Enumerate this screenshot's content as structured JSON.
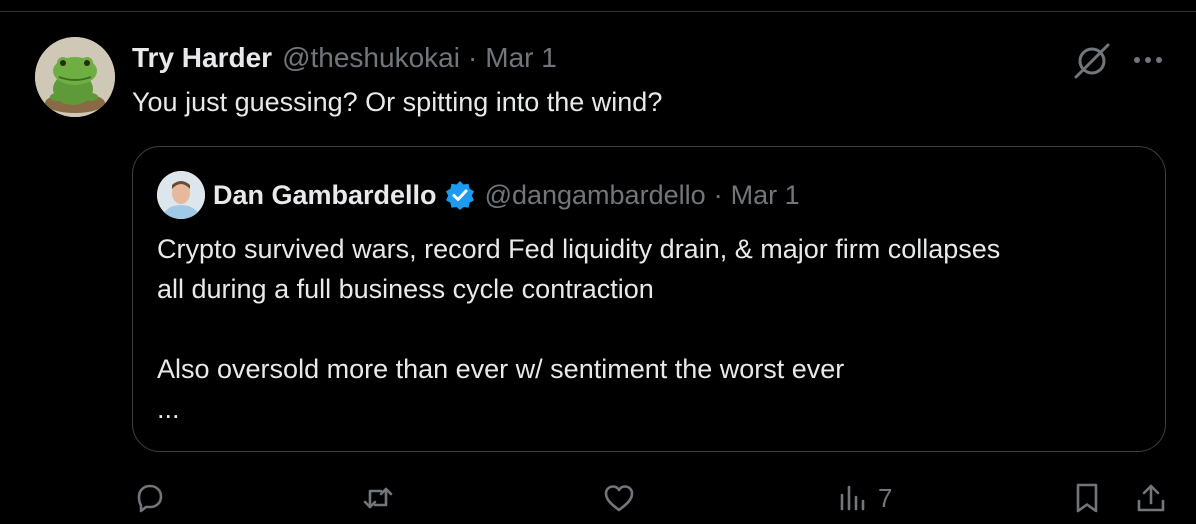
{
  "tweet": {
    "author_name": "Try Harder",
    "author_handle": "@theshukokai",
    "separator": "·",
    "date": "Mar 1",
    "text": "You just guessing? Or spitting into the wind?"
  },
  "quote": {
    "author_name": "Dan Gambardello",
    "author_handle": "@dangambardello",
    "separator": "·",
    "date": "Mar 1",
    "lines": [
      "Crypto survived wars, record Fed liquidity drain, & major firm collapses",
      "all during a full business cycle contraction",
      "",
      "Also oversold more than ever w/ sentiment the worst ever",
      "..."
    ]
  },
  "actions": {
    "reply_icon": "reply-icon",
    "retweet_icon": "retweet-icon",
    "like_icon": "heart-icon",
    "views_icon": "views-icon",
    "views_count": "7",
    "bookmark_icon": "bookmark-icon",
    "share_icon": "share-icon"
  },
  "colors": {
    "background": "#000000",
    "text_primary": "#e7e9ea",
    "text_secondary": "#71767b",
    "border": "#2f3336",
    "verified": "#1d9bf0"
  }
}
